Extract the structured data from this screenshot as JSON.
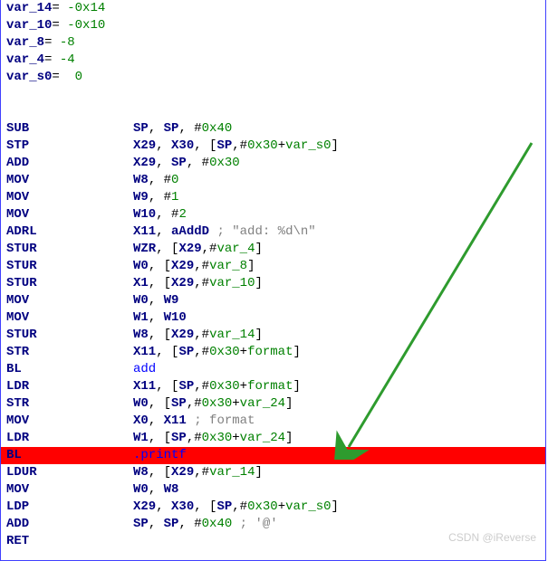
{
  "vars": [
    {
      "name": "var_14",
      "val": "-0x14"
    },
    {
      "name": "var_10",
      "val": "-0x10"
    },
    {
      "name": "var_8",
      "val": "-8"
    },
    {
      "name": "var_4",
      "val": "-4"
    },
    {
      "name": "var_s0",
      "val": " 0"
    }
  ],
  "lines": [
    {
      "mn": "SUB",
      "tokens": [
        [
          "reg",
          "SP"
        ],
        [
          "plain",
          ", "
        ],
        [
          "reg",
          "SP"
        ],
        [
          "plain",
          ", "
        ],
        [
          "plain",
          "#"
        ],
        [
          "num",
          "0x40"
        ]
      ]
    },
    {
      "mn": "STP",
      "tokens": [
        [
          "reg",
          "X29"
        ],
        [
          "plain",
          ", "
        ],
        [
          "reg",
          "X30"
        ],
        [
          "plain",
          ", ["
        ],
        [
          "reg",
          "SP"
        ],
        [
          "plain",
          ",#"
        ],
        [
          "off",
          "0x30"
        ],
        [
          "plain",
          "+"
        ],
        [
          "var",
          "var_s0"
        ],
        [
          "plain",
          "]"
        ]
      ]
    },
    {
      "mn": "ADD",
      "tokens": [
        [
          "reg",
          "X29"
        ],
        [
          "plain",
          ", "
        ],
        [
          "reg",
          "SP"
        ],
        [
          "plain",
          ", "
        ],
        [
          "plain",
          "#"
        ],
        [
          "num",
          "0x30"
        ]
      ]
    },
    {
      "mn": "MOV",
      "tokens": [
        [
          "reg",
          "W8"
        ],
        [
          "plain",
          ", "
        ],
        [
          "plain",
          "#"
        ],
        [
          "num",
          "0"
        ]
      ]
    },
    {
      "mn": "MOV",
      "tokens": [
        [
          "reg",
          "W9"
        ],
        [
          "plain",
          ", "
        ],
        [
          "plain",
          "#"
        ],
        [
          "num",
          "1"
        ]
      ]
    },
    {
      "mn": "MOV",
      "tokens": [
        [
          "reg",
          "W10"
        ],
        [
          "plain",
          ", "
        ],
        [
          "plain",
          "#"
        ],
        [
          "num",
          "2"
        ]
      ]
    },
    {
      "mn": "ADRL",
      "tokens": [
        [
          "reg",
          "X11"
        ],
        [
          "plain",
          ", "
        ],
        [
          "sym",
          "aAddD"
        ],
        [
          "plain",
          " "
        ],
        [
          "comment",
          "; \"add: %d\\n\""
        ]
      ]
    },
    {
      "mn": "STUR",
      "tokens": [
        [
          "reg",
          "WZR"
        ],
        [
          "plain",
          ", ["
        ],
        [
          "reg",
          "X29"
        ],
        [
          "plain",
          ",#"
        ],
        [
          "var",
          "var_4"
        ],
        [
          "plain",
          "]"
        ]
      ]
    },
    {
      "mn": "STUR",
      "tokens": [
        [
          "reg",
          "W0"
        ],
        [
          "plain",
          ", ["
        ],
        [
          "reg",
          "X29"
        ],
        [
          "plain",
          ",#"
        ],
        [
          "var",
          "var_8"
        ],
        [
          "plain",
          "]"
        ]
      ]
    },
    {
      "mn": "STUR",
      "tokens": [
        [
          "reg",
          "X1"
        ],
        [
          "plain",
          ", ["
        ],
        [
          "reg",
          "X29"
        ],
        [
          "plain",
          ",#"
        ],
        [
          "var",
          "var_10"
        ],
        [
          "plain",
          "]"
        ]
      ]
    },
    {
      "mn": "MOV",
      "tokens": [
        [
          "reg",
          "W0"
        ],
        [
          "plain",
          ", "
        ],
        [
          "reg",
          "W9"
        ]
      ]
    },
    {
      "mn": "MOV",
      "tokens": [
        [
          "reg",
          "W1"
        ],
        [
          "plain",
          ", "
        ],
        [
          "reg",
          "W10"
        ]
      ]
    },
    {
      "mn": "STUR",
      "tokens": [
        [
          "reg",
          "W8"
        ],
        [
          "plain",
          ", ["
        ],
        [
          "reg",
          "X29"
        ],
        [
          "plain",
          ",#"
        ],
        [
          "var",
          "var_14"
        ],
        [
          "plain",
          "]"
        ]
      ]
    },
    {
      "mn": "STR",
      "tokens": [
        [
          "reg",
          "X11"
        ],
        [
          "plain",
          ", ["
        ],
        [
          "reg",
          "SP"
        ],
        [
          "plain",
          ",#"
        ],
        [
          "off",
          "0x30"
        ],
        [
          "plain",
          "+"
        ],
        [
          "var",
          "format"
        ],
        [
          "plain",
          "]"
        ]
      ]
    },
    {
      "mn": "BL",
      "tokens": [
        [
          "label",
          "add"
        ]
      ]
    },
    {
      "mn": "LDR",
      "tokens": [
        [
          "reg",
          "X11"
        ],
        [
          "plain",
          ", ["
        ],
        [
          "reg",
          "SP"
        ],
        [
          "plain",
          ",#"
        ],
        [
          "off",
          "0x30"
        ],
        [
          "plain",
          "+"
        ],
        [
          "var",
          "format"
        ],
        [
          "plain",
          "]"
        ]
      ]
    },
    {
      "mn": "STR",
      "tokens": [
        [
          "reg",
          "W0"
        ],
        [
          "plain",
          ", ["
        ],
        [
          "reg",
          "SP"
        ],
        [
          "plain",
          ",#"
        ],
        [
          "off",
          "0x30"
        ],
        [
          "plain",
          "+"
        ],
        [
          "var",
          "var_24"
        ],
        [
          "plain",
          "]"
        ]
      ]
    },
    {
      "mn": "MOV",
      "tokens": [
        [
          "reg",
          "X0"
        ],
        [
          "plain",
          ", "
        ],
        [
          "reg",
          "X11"
        ],
        [
          "plain",
          " "
        ],
        [
          "comment",
          "; format"
        ]
      ]
    },
    {
      "mn": "LDR",
      "tokens": [
        [
          "reg",
          "W1"
        ],
        [
          "plain",
          ", ["
        ],
        [
          "reg",
          "SP"
        ],
        [
          "plain",
          ",#"
        ],
        [
          "off",
          "0x30"
        ],
        [
          "plain",
          "+"
        ],
        [
          "var",
          "var_24"
        ],
        [
          "plain",
          "]"
        ]
      ]
    },
    {
      "mn": "BL",
      "tokens": [
        [
          "label",
          ".printf"
        ]
      ],
      "hl": true
    },
    {
      "mn": "LDUR",
      "tokens": [
        [
          "reg",
          "W8"
        ],
        [
          "plain",
          ", ["
        ],
        [
          "reg",
          "X29"
        ],
        [
          "plain",
          ",#"
        ],
        [
          "var",
          "var_14"
        ],
        [
          "plain",
          "]"
        ]
      ]
    },
    {
      "mn": "MOV",
      "tokens": [
        [
          "reg",
          "W0"
        ],
        [
          "plain",
          ", "
        ],
        [
          "reg",
          "W8"
        ]
      ]
    },
    {
      "mn": "LDP",
      "tokens": [
        [
          "reg",
          "X29"
        ],
        [
          "plain",
          ", "
        ],
        [
          "reg",
          "X30"
        ],
        [
          "plain",
          ", ["
        ],
        [
          "reg",
          "SP"
        ],
        [
          "plain",
          ",#"
        ],
        [
          "off",
          "0x30"
        ],
        [
          "plain",
          "+"
        ],
        [
          "var",
          "var_s0"
        ],
        [
          "plain",
          "]"
        ]
      ]
    },
    {
      "mn": "ADD",
      "tokens": [
        [
          "reg",
          "SP"
        ],
        [
          "plain",
          ", "
        ],
        [
          "reg",
          "SP"
        ],
        [
          "plain",
          ", "
        ],
        [
          "plain",
          "#"
        ],
        [
          "num",
          "0x40"
        ],
        [
          "plain",
          " "
        ],
        [
          "comment",
          "; '@'"
        ]
      ]
    },
    {
      "mn": "RET",
      "tokens": []
    }
  ],
  "watermark": "CSDN @iReverse"
}
